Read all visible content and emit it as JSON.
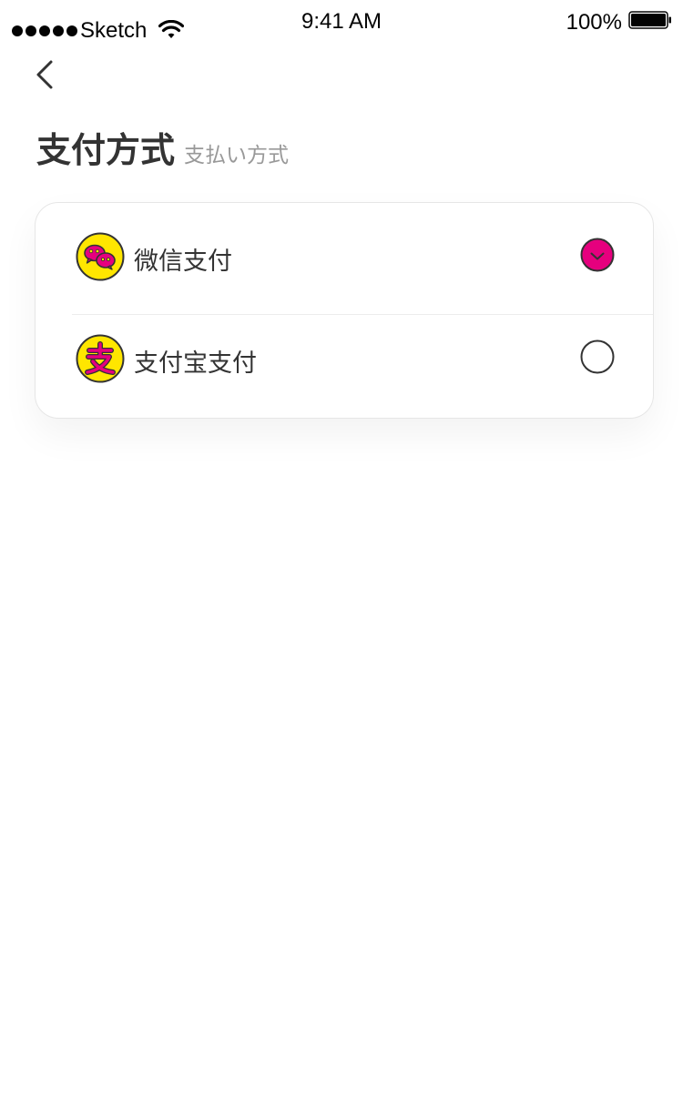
{
  "status_bar": {
    "carrier": "Sketch",
    "time": "9:41 AM",
    "battery": "100%"
  },
  "header": {
    "title": "支付方式",
    "subtitle": "支払い方式"
  },
  "payment_options": [
    {
      "label": "微信支付",
      "icon": "wechat-icon",
      "selected": true
    },
    {
      "label": "支付宝支付",
      "icon": "alipay-icon",
      "selected": false
    }
  ],
  "colors": {
    "accent": "#e6007e",
    "icon_bg": "#ffe600",
    "text": "#333333",
    "subtitle": "#999999"
  }
}
